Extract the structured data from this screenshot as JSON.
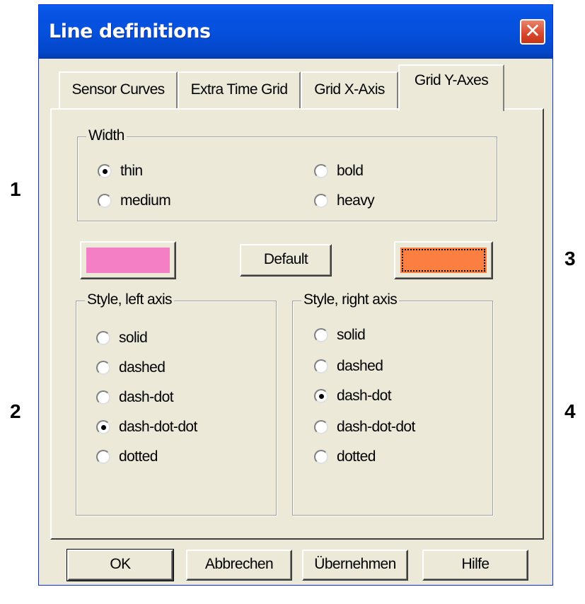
{
  "window": {
    "title": "Line definitions",
    "close_glyph": "✕"
  },
  "callouts": [
    "1",
    "2",
    "3",
    "4"
  ],
  "tabs": [
    {
      "label": "Sensor Curves",
      "active": false
    },
    {
      "label": "Extra Time Grid",
      "active": false
    },
    {
      "label": "Grid X-Axis",
      "active": false
    },
    {
      "label": "Grid Y-Axes",
      "active": true
    }
  ],
  "width_group": {
    "label": "Width",
    "options": [
      {
        "label": "thin",
        "selected": true
      },
      {
        "label": "bold",
        "selected": false
      },
      {
        "label": "medium",
        "selected": false
      },
      {
        "label": "heavy",
        "selected": false
      }
    ]
  },
  "colors": {
    "left_axis": "#F47FC4",
    "right_axis": "#FA7F40"
  },
  "default_button": "Default",
  "left_style": {
    "label": "Style, left axis",
    "options": [
      {
        "label": "solid",
        "selected": false
      },
      {
        "label": "dashed",
        "selected": false
      },
      {
        "label": "dash-dot",
        "selected": false
      },
      {
        "label": "dash-dot-dot",
        "selected": true
      },
      {
        "label": "dotted",
        "selected": false
      }
    ]
  },
  "right_style": {
    "label": "Style, right axis",
    "options": [
      {
        "label": "solid",
        "selected": false
      },
      {
        "label": "dashed",
        "selected": false
      },
      {
        "label": "dash-dot",
        "selected": true
      },
      {
        "label": "dash-dot-dot",
        "selected": false
      },
      {
        "label": "dotted",
        "selected": false
      }
    ]
  },
  "footer": {
    "ok": "OK",
    "cancel": "Abbrechen",
    "apply": "Übernehmen",
    "help": "Hilfe"
  }
}
